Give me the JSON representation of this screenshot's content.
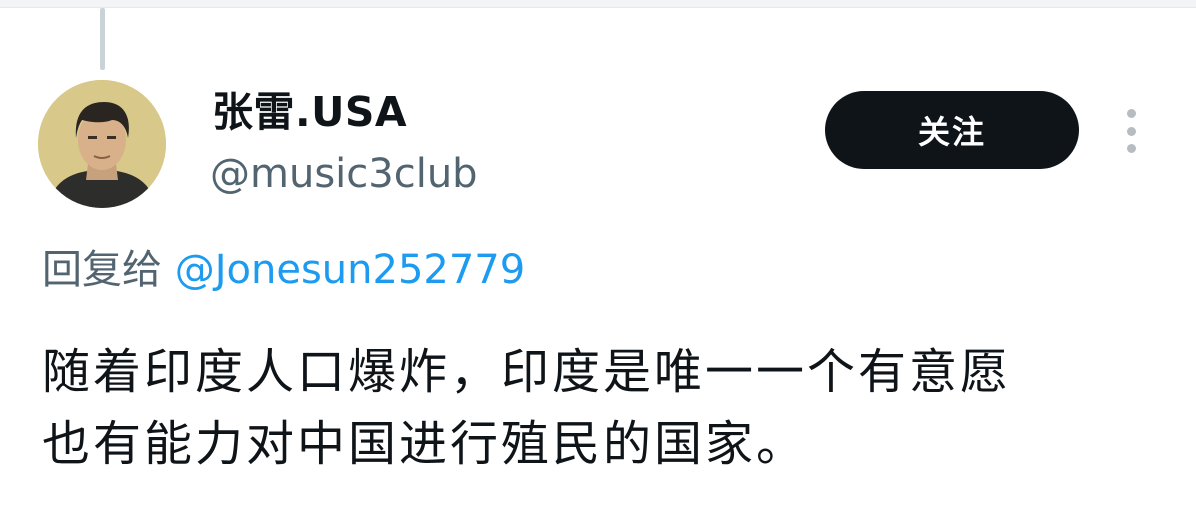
{
  "author": {
    "display_name": "张雷.USA",
    "handle": "@music3club",
    "avatar_icon": "person-avatar-icon"
  },
  "actions": {
    "follow_label": "关注",
    "more_icon": "more-vertical-icon"
  },
  "reply": {
    "prefix": "回复给",
    "mention": "@Jonesun252779"
  },
  "tweet": {
    "lines": [
      "随着印度人口爆炸，印度是唯一一个有意愿",
      "也有能力对中国进行殖民的国家。"
    ]
  },
  "colors": {
    "text_primary": "#0f1419",
    "text_secondary": "#536471",
    "link": "#1d9bf0",
    "button_bg": "#0f1419"
  }
}
